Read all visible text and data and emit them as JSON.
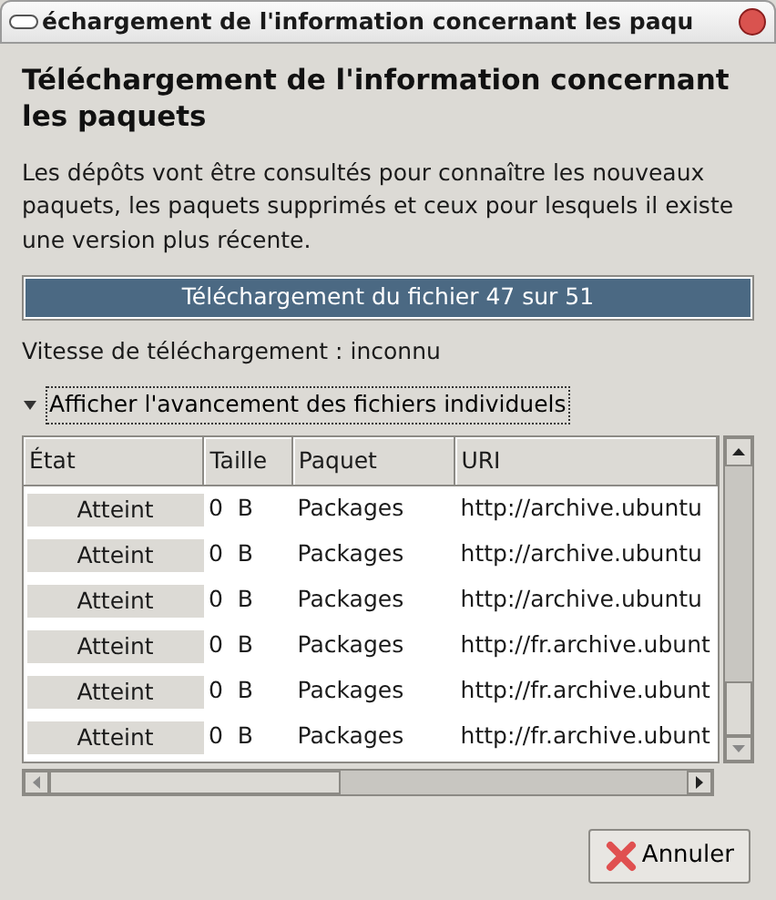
{
  "window": {
    "title": "échargement de l'information concernant les paqu"
  },
  "heading": "Téléchargement de l'information concernant les paquets",
  "description": "Les dépôts vont être consultés pour connaître les nouveaux paquets, les paquets supprimés et ceux pour lesquels il existe une version plus récente.",
  "progress": {
    "level": 1,
    "text": "Téléchargement du fichier 47 sur 51"
  },
  "speed": "Vitesse de téléchargement : inconnu",
  "expander": {
    "label": "Afficher l'avancement des fichiers individuels",
    "expanded": true
  },
  "table": {
    "columns": [
      "État",
      "Taille",
      "Paquet",
      "URI"
    ],
    "rows": [
      {
        "state": "Atteint",
        "size": "0  B",
        "package": "Packages",
        "uri": "http://archive.ubuntu"
      },
      {
        "state": "Atteint",
        "size": "0  B",
        "package": "Packages",
        "uri": "http://archive.ubuntu"
      },
      {
        "state": "Atteint",
        "size": "0  B",
        "package": "Packages",
        "uri": "http://archive.ubuntu"
      },
      {
        "state": "Atteint",
        "size": "0  B",
        "package": "Packages",
        "uri": "http://fr.archive.ubunt"
      },
      {
        "state": "Atteint",
        "size": "0  B",
        "package": "Packages",
        "uri": "http://fr.archive.ubunt"
      },
      {
        "state": "Atteint",
        "size": "0  B",
        "package": "Packages",
        "uri": "http://fr.archive.ubunt"
      }
    ]
  },
  "buttons": [
    "Annuler"
  ]
}
